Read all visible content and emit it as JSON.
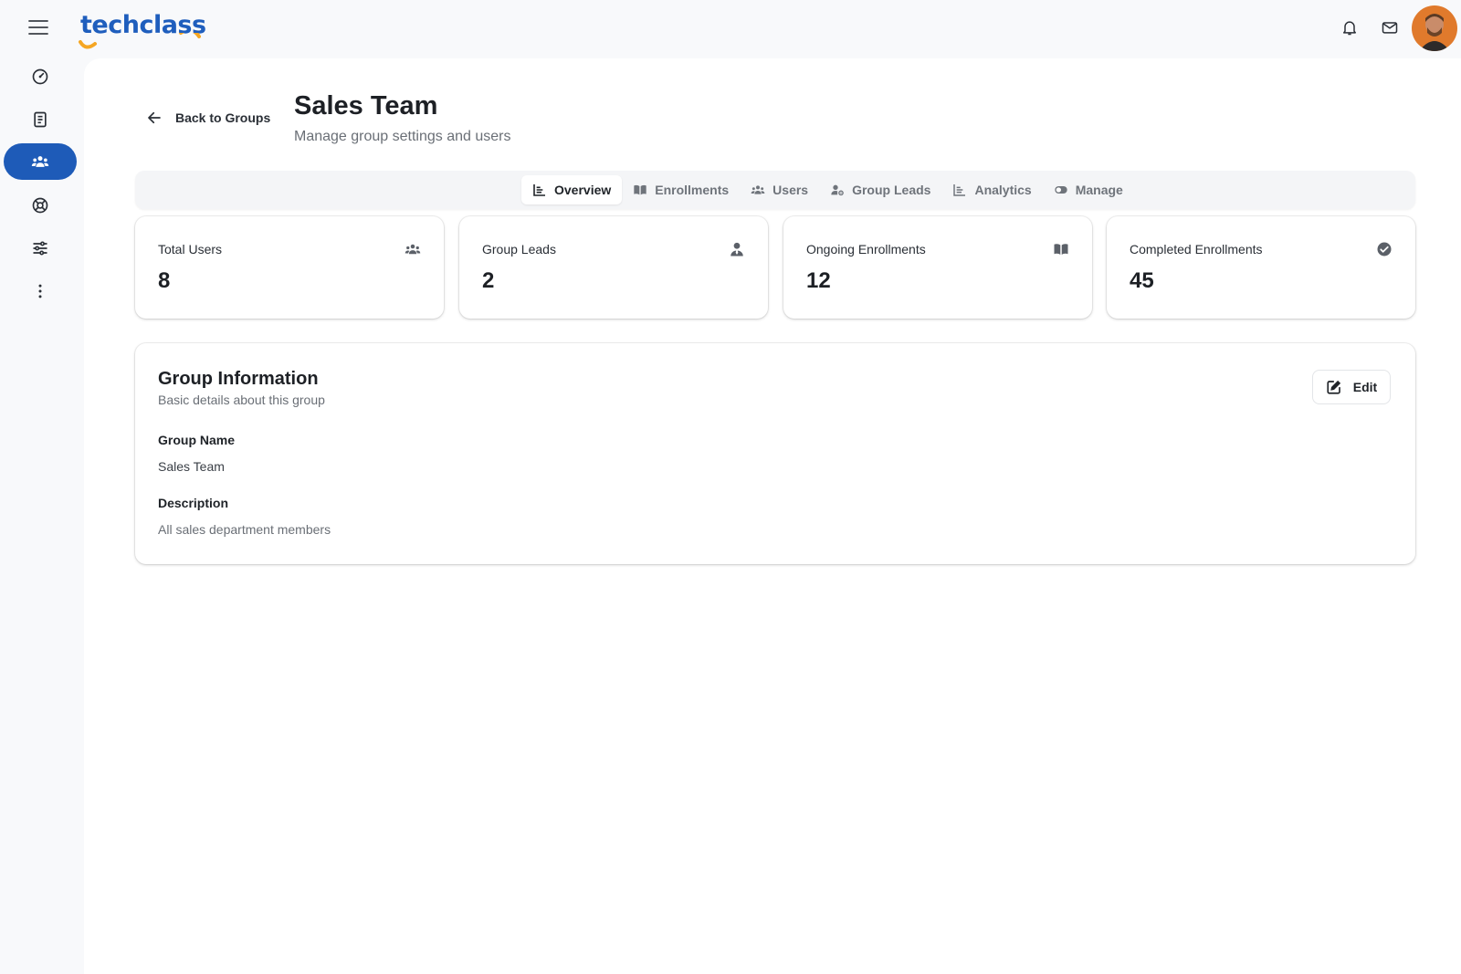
{
  "app": {
    "logo": "techclass"
  },
  "colors": {
    "brand": "#1e5bb8",
    "logo_accent": "#f5a623"
  },
  "topbar": {
    "icons": [
      "menu-icon",
      "bell-icon",
      "mail-icon"
    ]
  },
  "sidebar": {
    "items": [
      {
        "name": "dashboard",
        "icon": "gauge-icon",
        "active": false
      },
      {
        "name": "courses",
        "icon": "notebook-icon",
        "active": false
      },
      {
        "name": "groups",
        "icon": "users-icon",
        "active": true
      },
      {
        "name": "support",
        "icon": "lifebuoy-icon",
        "active": false
      },
      {
        "name": "settings",
        "icon": "sliders-icon",
        "active": false
      },
      {
        "name": "more",
        "icon": "more-vertical-icon",
        "active": false
      }
    ]
  },
  "header": {
    "back_label": "Back to Groups",
    "title": "Sales Team",
    "subtitle": "Manage group settings and users"
  },
  "tabs": [
    {
      "label": "Overview",
      "icon": "chart-icon",
      "active": true
    },
    {
      "label": "Enrollments",
      "icon": "book-icon",
      "active": false
    },
    {
      "label": "Users",
      "icon": "users-icon",
      "active": false
    },
    {
      "label": "Group Leads",
      "icon": "user-gear-icon",
      "active": false
    },
    {
      "label": "Analytics",
      "icon": "chart-icon",
      "active": false
    },
    {
      "label": "Manage",
      "icon": "toggle-icon",
      "active": false
    }
  ],
  "stats": [
    {
      "label": "Total Users",
      "value": "8",
      "icon": "users-icon"
    },
    {
      "label": "Group Leads",
      "value": "2",
      "icon": "user-tie-icon"
    },
    {
      "label": "Ongoing Enrollments",
      "value": "12",
      "icon": "book-icon"
    },
    {
      "label": "Completed Enrollments",
      "value": "45",
      "icon": "check-circle-icon"
    }
  ],
  "group_info": {
    "title": "Group Information",
    "subtitle": "Basic details about this group",
    "edit_label": "Edit",
    "name_label": "Group Name",
    "name_value": "Sales Team",
    "description_label": "Description",
    "description_value": "All sales department members"
  }
}
